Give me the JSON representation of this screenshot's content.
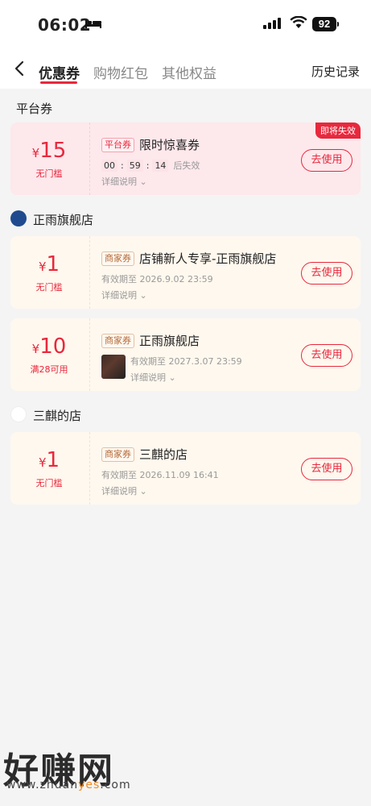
{
  "status_bar": {
    "time": "06:02",
    "battery": "92"
  },
  "nav": {
    "tabs": [
      "优惠券",
      "购物红包",
      "其他权益"
    ],
    "active_tab": 0,
    "history": "历史记录"
  },
  "sections": {
    "platform": {
      "title": "平台券"
    },
    "shop1": {
      "name": "正雨旗舰店"
    },
    "shop2": {
      "name": "三麒的店"
    }
  },
  "coupons": [
    {
      "currency": "¥",
      "amount": "15",
      "condition": "无门槛",
      "tag": "平台券",
      "title": "限时惊喜券",
      "timer": {
        "h": "00",
        "m": "59",
        "s": "14",
        "suffix": "后失效"
      },
      "flag": "即将失效",
      "detail": "详细说明",
      "button": "去使用"
    },
    {
      "currency": "¥",
      "amount": "1",
      "condition": "无门槛",
      "tag": "商家券",
      "title": "店铺新人专享-正雨旗舰店",
      "expiry": "有效期至 2026.9.02 23:59",
      "detail": "详细说明",
      "button": "去使用"
    },
    {
      "currency": "¥",
      "amount": "10",
      "condition": "满28可用",
      "tag": "商家券",
      "title": "正雨旗舰店",
      "expiry": "有效期至 2027.3.07 23:59",
      "detail": "详细说明",
      "button": "去使用"
    },
    {
      "currency": "¥",
      "amount": "1",
      "condition": "无门槛",
      "tag": "商家券",
      "title": "三麒的店",
      "expiry": "有效期至 2026.11.09 16:41",
      "detail": "详细说明",
      "button": "去使用"
    }
  ],
  "watermark": {
    "text": "好赚网",
    "url_prefix": "www.zhuan",
    "url_highlight": "yes",
    "url_suffix": ".com"
  }
}
